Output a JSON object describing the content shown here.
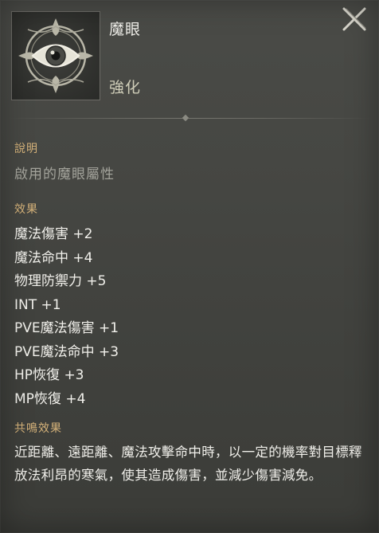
{
  "item": {
    "icon": "eye-sigil-icon",
    "name": "魔眼",
    "type": "強化"
  },
  "description": {
    "title": "說明",
    "text": "啟用的魔眼屬性"
  },
  "effects": {
    "title": "效果",
    "items": [
      "魔法傷害 +2",
      "魔法命中 +4",
      "物理防禦力 +5",
      "INT +1",
      "PVE魔法傷害 +1",
      "PVE魔法命中 +3",
      "HP恢復 +3",
      "MP恢復 +4"
    ]
  },
  "resonance": {
    "title": "共鳴效果",
    "text": "近距離、遠距離、魔法攻擊命中時，以一定的機率對目標釋放法利昂的寒氣，使其造成傷害，並減少傷害減免。"
  },
  "close_icon": "close-icon",
  "colors": {
    "section_title": "#d6b37a",
    "muted_text": "#a3a39b",
    "primary_text": "#f0efea",
    "type_text": "#cfcdb8"
  }
}
